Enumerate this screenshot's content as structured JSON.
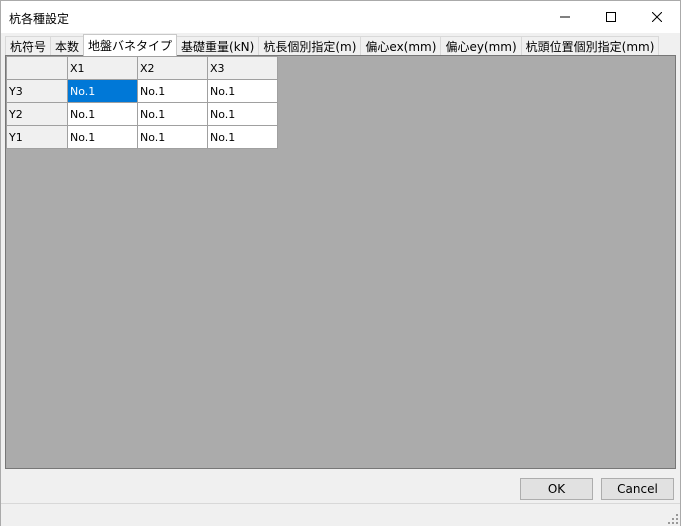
{
  "window": {
    "title": "杭各種設定",
    "minimize_icon": "minimize-icon",
    "maximize_icon": "maximize-icon",
    "close_icon": "close-icon"
  },
  "tabs": [
    {
      "label": "杭符号",
      "active": false
    },
    {
      "label": "本数",
      "active": false
    },
    {
      "label": "地盤バネタイプ",
      "active": true
    },
    {
      "label": "基礎重量(kN)",
      "active": false
    },
    {
      "label": "杭長個別指定(m)",
      "active": false
    },
    {
      "label": "偏心ex(mm)",
      "active": false
    },
    {
      "label": "偏心ey(mm)",
      "active": false
    },
    {
      "label": "杭頭位置個別指定(mm)",
      "active": false
    }
  ],
  "grid": {
    "columns": [
      "X1",
      "X2",
      "X3"
    ],
    "rows": [
      {
        "label": "Y3",
        "cells": [
          "No.1",
          "No.1",
          "No.1"
        ]
      },
      {
        "label": "Y2",
        "cells": [
          "No.1",
          "No.1",
          "No.1"
        ]
      },
      {
        "label": "Y1",
        "cells": [
          "No.1",
          "No.1",
          "No.1"
        ]
      }
    ],
    "selected_color": "#0078d7"
  },
  "buttons": {
    "ok": "OK",
    "cancel": "Cancel"
  }
}
